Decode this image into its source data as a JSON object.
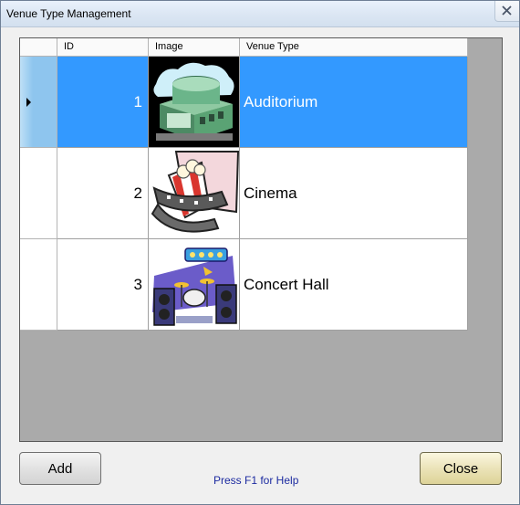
{
  "window": {
    "title": "Venue Type Management"
  },
  "grid": {
    "columns": [
      "ID",
      "Image",
      "Venue Type"
    ],
    "rows": [
      {
        "id": "1",
        "image": "auditorium-building-icon",
        "venue_type": "Auditorium",
        "selected": true
      },
      {
        "id": "2",
        "image": "cinema-popcorn-film-icon",
        "venue_type": "Cinema",
        "selected": false
      },
      {
        "id": "3",
        "image": "concert-hall-stage-icon",
        "venue_type": "Concert Hall",
        "selected": false
      }
    ]
  },
  "buttons": {
    "add": "Add",
    "close": "Close"
  },
  "help_text": "Press F1 for Help",
  "colors": {
    "selection": "#3399ff",
    "row_header_selected": "#8ec5ee",
    "grid_background": "#aaaaaa",
    "help_text": "#1b2aa0"
  }
}
